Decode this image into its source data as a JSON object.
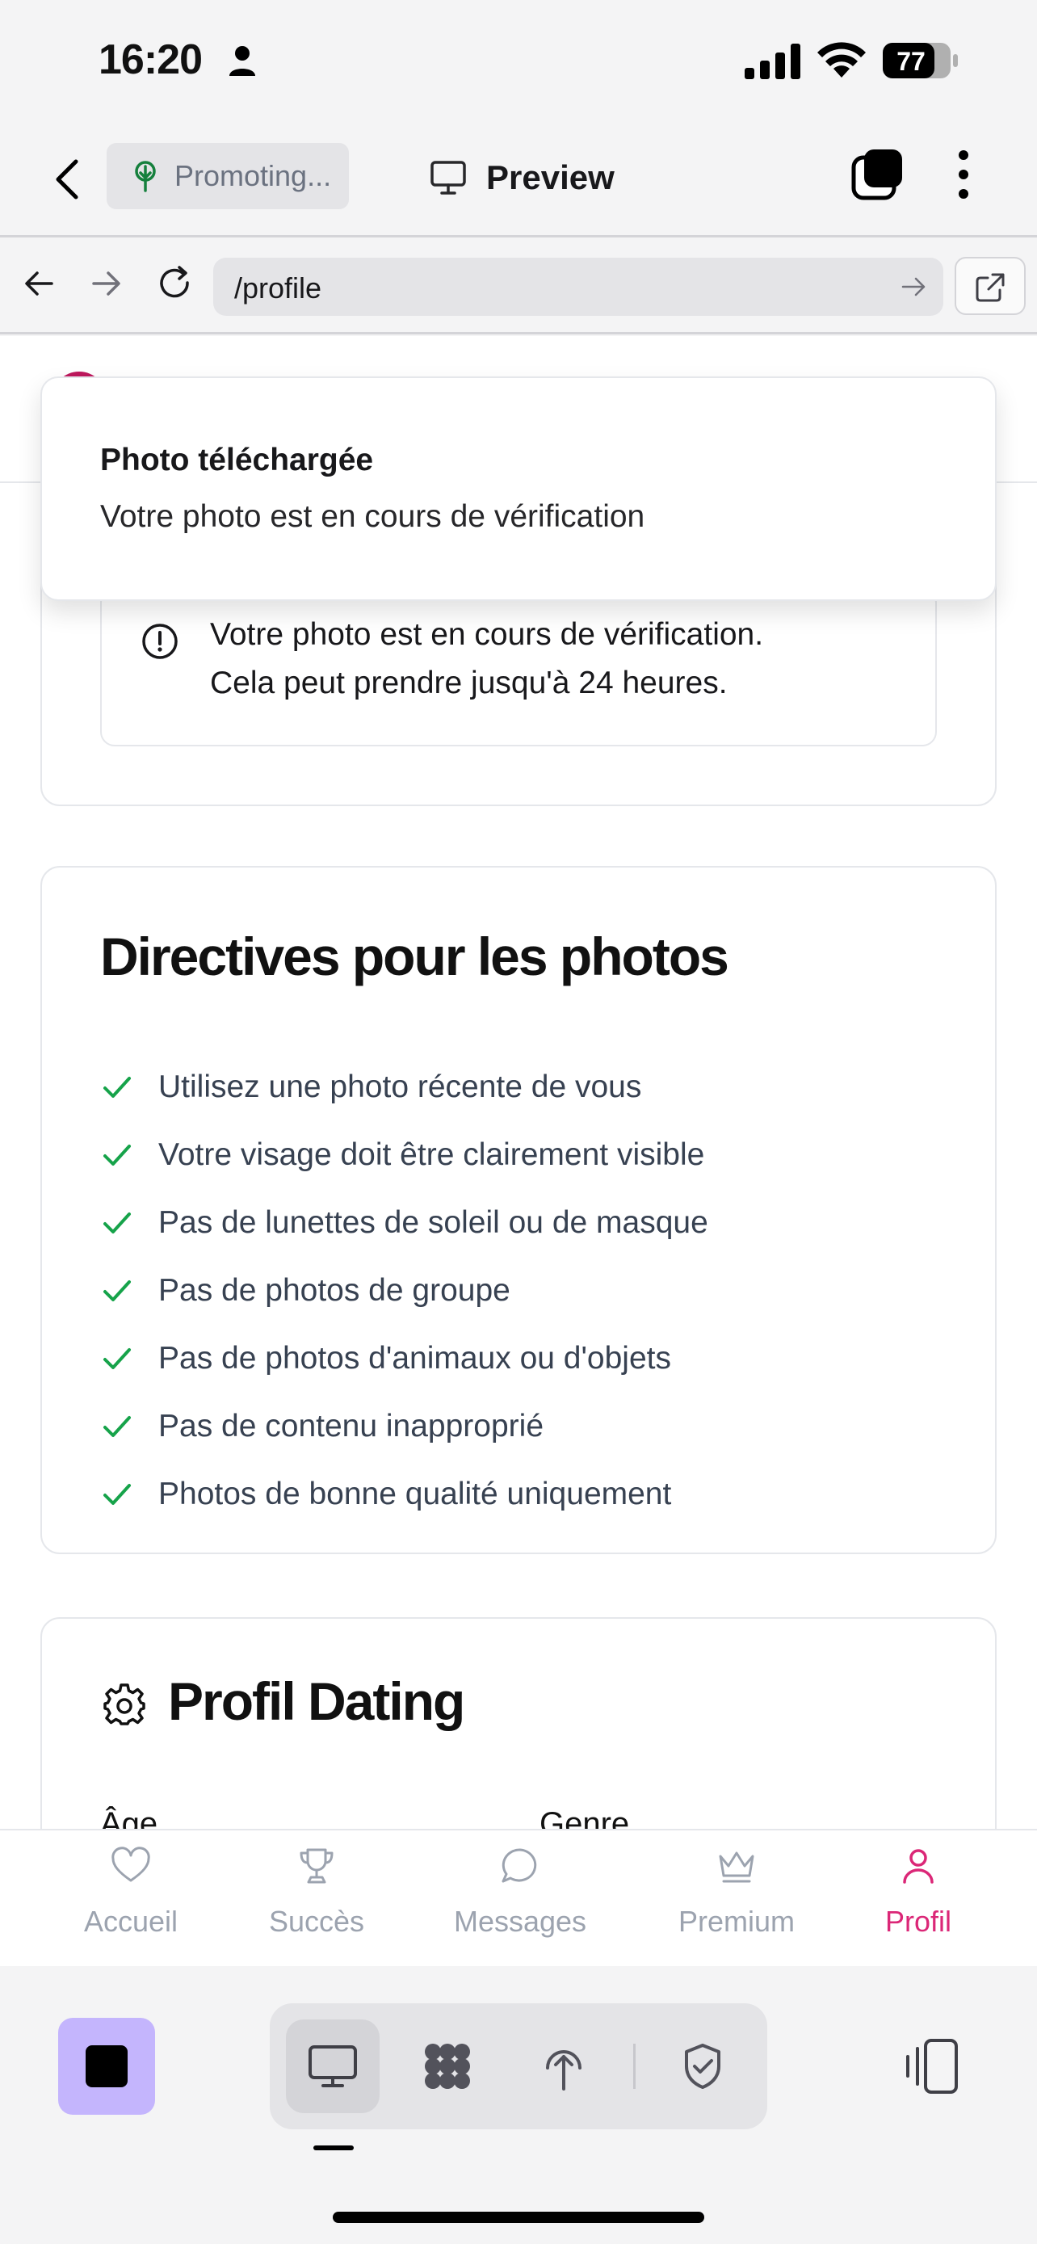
{
  "status_bar": {
    "time": "16:20",
    "battery": "77"
  },
  "top_bar": {
    "chip_label": "Promoting...",
    "preview_label": "Preview"
  },
  "url_bar": {
    "path": "/profile"
  },
  "toast": {
    "title": "Photo téléchargée",
    "description": "Votre photo est en cours de vérification"
  },
  "status_card": {
    "alert_line1": "Votre photo est en cours de vérification.",
    "alert_line2": "Cela peut prendre jusqu'à 24 heures."
  },
  "guidelines": {
    "title": "Directives pour les photos",
    "items": [
      "Utilisez une photo récente de vous",
      "Votre visage doit être clairement visible",
      "Pas de lunettes de soleil ou de masque",
      "Pas de photos de groupe",
      "Pas de photos d'animaux ou d'objets",
      "Pas de contenu inapproprié",
      "Photos de bonne qualité uniquement"
    ]
  },
  "dating_profile": {
    "title": "Profil Dating",
    "age_label": "Âge",
    "gender_label": "Genre"
  },
  "tabs": [
    {
      "label": "Accueil",
      "icon": "heart-icon"
    },
    {
      "label": "Succès",
      "icon": "trophy-icon"
    },
    {
      "label": "Messages",
      "icon": "chat-bubble-icon"
    },
    {
      "label": "Premium",
      "icon": "crown-icon"
    },
    {
      "label": "Profil",
      "icon": "user-icon"
    }
  ],
  "active_tab": "Profil",
  "colors": {
    "accent": "#db2777",
    "success_check": "#16a34a",
    "stop_button": "#c4b5fd"
  }
}
